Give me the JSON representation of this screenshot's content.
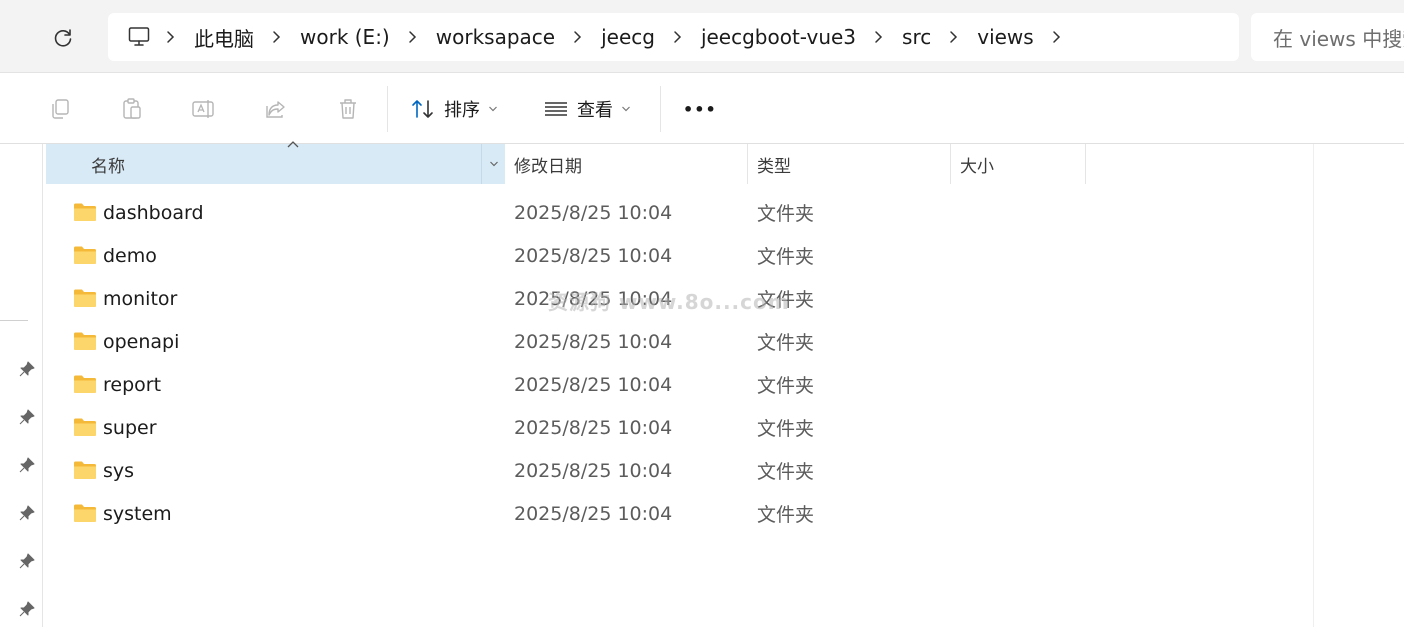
{
  "address_bar": {
    "breadcrumbs": [
      "此电脑",
      "work (E:)",
      "worksapace",
      "jeecg",
      "jeecgboot-vue3",
      "src",
      "views"
    ],
    "root_icon": "computer-icon",
    "separator_icon": "chevron-right-icon"
  },
  "search": {
    "placeholder": "在 views 中搜索"
  },
  "toolbar": {
    "sort_label": "排序",
    "view_label": "查看",
    "more_label": "•••",
    "icons": [
      "copy-icon",
      "paste-icon",
      "rename-icon",
      "share-icon",
      "delete-icon"
    ]
  },
  "columns": {
    "name": "名称",
    "modified": "修改日期",
    "type": "类型",
    "size": "大小"
  },
  "files": [
    {
      "name": "dashboard",
      "modified": "2025/8/25 10:04",
      "type": "文件夹"
    },
    {
      "name": "demo",
      "modified": "2025/8/25 10:04",
      "type": "文件夹"
    },
    {
      "name": "monitor",
      "modified": "2025/8/25 10:04",
      "type": "文件夹"
    },
    {
      "name": "openapi",
      "modified": "2025/8/25 10:04",
      "type": "文件夹"
    },
    {
      "name": "report",
      "modified": "2025/8/25 10:04",
      "type": "文件夹"
    },
    {
      "name": "super",
      "modified": "2025/8/25 10:04",
      "type": "文件夹"
    },
    {
      "name": "sys",
      "modified": "2025/8/25 10:04",
      "type": "文件夹"
    },
    {
      "name": "system",
      "modified": "2025/8/25 10:04",
      "type": "文件夹"
    }
  ],
  "watermark": "资源狗 www.8o...com",
  "colors": {
    "header_selected": "#d9eaf7",
    "folder": "#f8c94a",
    "accent": "#0067c0"
  }
}
